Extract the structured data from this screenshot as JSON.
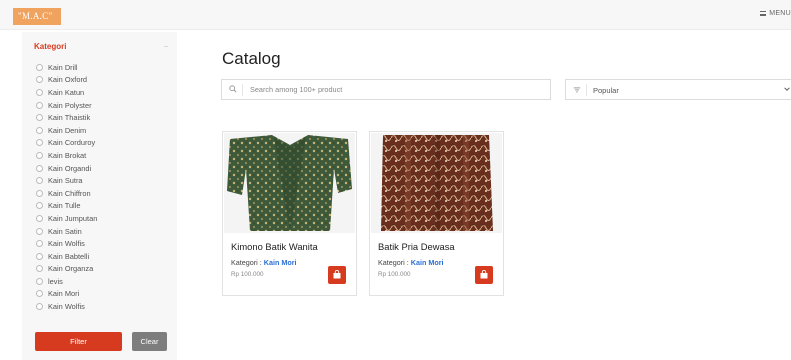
{
  "header": {
    "logo_text": "\"M.A.C\"",
    "menu_label": "MENU"
  },
  "sidebar": {
    "title": "Kategori",
    "toggle_icon": "minus-icon",
    "categories": [
      "Kain Drill",
      "Kain Oxford",
      "Kain Katun",
      "Kain Polyster",
      "Kain Thaistik",
      "Kain Denim",
      "Kain Corduroy",
      "Kain Brokat",
      "Kain Organdi",
      "Kain Sutra",
      "Kain Chiffron",
      "Kain Tulle",
      "Kain Jumputan",
      "Kain Satin",
      "Kain Wolfis",
      "Kain Babtelli",
      "Kain Organza",
      "levis",
      "Kain Mori",
      "Kain Wolfis"
    ],
    "filter_label": "Filter",
    "clear_label": "Clear"
  },
  "main": {
    "title": "Catalog",
    "search": {
      "placeholder": "Search among 100+ product",
      "value": ""
    },
    "sort": {
      "selected": "Popular"
    },
    "products": [
      {
        "name": "Kimono Batik Wanita",
        "category_prefix": "Kategori : ",
        "category": "Kain Mori",
        "price": "Rp 100.000"
      },
      {
        "name": "Batik Pria Dewasa",
        "category_prefix": "Kategori : ",
        "category": "Kain Mori",
        "price": "Rp 100.000"
      }
    ]
  },
  "colors": {
    "accent": "#d63a1f",
    "logo_bg": "#f0a35e",
    "link": "#2a6fd6",
    "clear_btn": "#7d7d7d"
  }
}
